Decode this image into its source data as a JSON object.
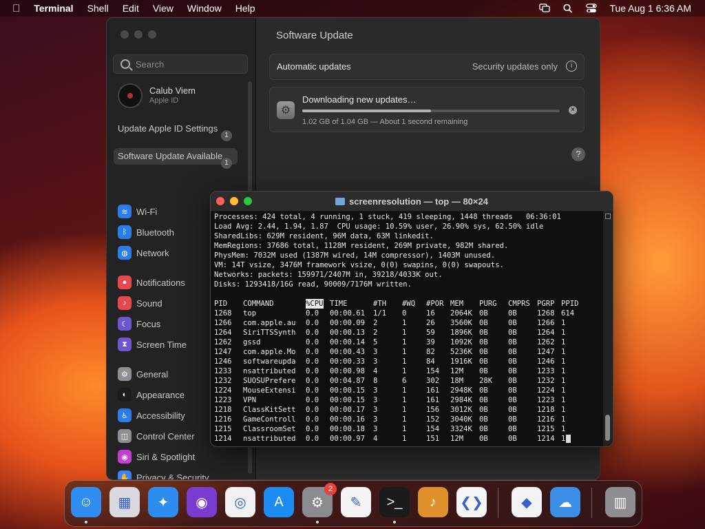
{
  "menubar": {
    "app": "Terminal",
    "items": [
      "Shell",
      "Edit",
      "View",
      "Window",
      "Help"
    ],
    "clock": "Tue Aug 1  6:36 AM"
  },
  "settings": {
    "search_placeholder": "Search",
    "account": {
      "name": "Calub Viem",
      "sub": "Apple ID"
    },
    "notices": [
      {
        "label": "Update Apple ID Settings",
        "badge": "1"
      },
      {
        "label": "Software Update Available",
        "badge": "1"
      }
    ],
    "nav": [
      {
        "label": "Wi-Fi",
        "color": "#2b7de9"
      },
      {
        "label": "Bluetooth",
        "color": "#2b7de9"
      },
      {
        "label": "Network",
        "color": "#2b7de9"
      },
      {
        "label": "Notifications",
        "color": "#e5484d"
      },
      {
        "label": "Sound",
        "color": "#e5484d"
      },
      {
        "label": "Focus",
        "color": "#6e56cf"
      },
      {
        "label": "Screen Time",
        "color": "#6e56cf"
      },
      {
        "label": "General",
        "color": "#8e8e93"
      },
      {
        "label": "Appearance",
        "color": "#1c1c1e"
      },
      {
        "label": "Accessibility",
        "color": "#2b7de9"
      },
      {
        "label": "Control Center",
        "color": "#8e8e93"
      },
      {
        "label": "Siri & Spotlight",
        "color": "#c23fd1"
      },
      {
        "label": "Privacy & Security",
        "color": "#3b82f6"
      }
    ],
    "title": "Software Update",
    "auto_updates": {
      "label": "Automatic updates",
      "value": "Security updates only"
    },
    "download": {
      "title": "Downloading new updates…",
      "status": "1.02 GB of 1.04 GB — About 1 second remaining",
      "progress": 0.5
    },
    "help": "?"
  },
  "terminal": {
    "title": "screenresolution — top — 80×24",
    "summary": [
      "Processes: 424 total, 4 running, 1 stuck, 419 sleeping, 1448 threads   06:36:01",
      "Load Avg: 2.44, 1.94, 1.87  CPU usage: 10.59% user, 26.90% sys, 62.50% idle",
      "SharedLibs: 629M resident, 96M data, 63M linkedit.",
      "MemRegions: 37686 total, 1128M resident, 269M private, 982M shared.",
      "PhysMem: 7032M used (1387M wired, 14M compressor), 1403M unused.",
      "VM: 14T vsize, 3476M framework vsize, 0(0) swapins, 0(0) swapouts.",
      "Networks: packets: 159971/2407M in, 39218/4033K out.",
      "Disks: 1293418/16G read, 90009/7176M written."
    ],
    "columns": [
      "PID",
      "COMMAND",
      "%CPU",
      "TIME",
      "#TH",
      "#WQ",
      "#POR",
      "MEM",
      "PURG",
      "CMPRS",
      "PGRP",
      "PPID"
    ],
    "rows": [
      [
        "1268",
        "top",
        "0.0",
        "00:00.61",
        "1/1",
        "0",
        "16",
        "2064K",
        "0B",
        "0B",
        "1268",
        "614"
      ],
      [
        "1266",
        "com.apple.au",
        "0.0",
        "00:00.09",
        "2",
        "1",
        "26",
        "3560K",
        "0B",
        "0B",
        "1266",
        "1"
      ],
      [
        "1264",
        "SiriTTSSynth",
        "0.0",
        "00:00.13",
        "2",
        "1",
        "59",
        "1896K",
        "0B",
        "0B",
        "1264",
        "1"
      ],
      [
        "1262",
        "gssd",
        "0.0",
        "00:00.14",
        "5",
        "1",
        "39",
        "1092K",
        "0B",
        "0B",
        "1262",
        "1"
      ],
      [
        "1247",
        "com.apple.Mo",
        "0.0",
        "00:00.43",
        "3",
        "1",
        "82",
        "5236K",
        "0B",
        "0B",
        "1247",
        "1"
      ],
      [
        "1246",
        "softwareupda",
        "0.0",
        "00:00.33",
        "3",
        "1",
        "84",
        "1916K",
        "0B",
        "0B",
        "1246",
        "1"
      ],
      [
        "1233",
        "nsattributed",
        "0.0",
        "00:00.98",
        "4",
        "1",
        "154",
        "12M",
        "0B",
        "0B",
        "1233",
        "1"
      ],
      [
        "1232",
        "SUOSUPrefere",
        "0.0",
        "00:04.87",
        "8",
        "6",
        "302",
        "18M",
        "28K",
        "0B",
        "1232",
        "1"
      ],
      [
        "1224",
        "MouseExtensi",
        "0.0",
        "00:00.15",
        "3",
        "1",
        "161",
        "2948K",
        "0B",
        "0B",
        "1224",
        "1"
      ],
      [
        "1223",
        "VPN",
        "0.0",
        "00:00.15",
        "3",
        "1",
        "161",
        "2984K",
        "0B",
        "0B",
        "1223",
        "1"
      ],
      [
        "1218",
        "ClassKitSett",
        "0.0",
        "00:00.17",
        "3",
        "1",
        "156",
        "3012K",
        "0B",
        "0B",
        "1218",
        "1"
      ],
      [
        "1216",
        "GameControll",
        "0.0",
        "00:00.16",
        "3",
        "1",
        "152",
        "3040K",
        "0B",
        "0B",
        "1216",
        "1"
      ],
      [
        "1215",
        "ClassroomSet",
        "0.0",
        "00:00.18",
        "3",
        "1",
        "154",
        "3324K",
        "0B",
        "0B",
        "1215",
        "1"
      ],
      [
        "1214",
        "nsattributed",
        "0.0",
        "00:00.97",
        "4",
        "1",
        "151",
        "12M",
        "0B",
        "0B",
        "1214",
        "1"
      ]
    ]
  },
  "dock": [
    {
      "name": "finder-icon",
      "glyph": "☺",
      "bg": "#2f8cf0",
      "dot": true
    },
    {
      "name": "launchpad-icon",
      "glyph": "▦",
      "bg": "#d9d9de",
      "dot": false
    },
    {
      "name": "safari-icon",
      "glyph": "✦",
      "bg": "#2d8cf0",
      "dot": false
    },
    {
      "name": "firefox-icon",
      "glyph": "◉",
      "bg": "#7a3bd0",
      "dot": false
    },
    {
      "name": "chrome-icon",
      "glyph": "◎",
      "bg": "#f1f1f1",
      "dot": false
    },
    {
      "name": "app-store-icon",
      "glyph": "A",
      "bg": "#1a8cf2",
      "dot": false
    },
    {
      "name": "system-settings-icon",
      "glyph": "⚙",
      "bg": "#8a8a8f",
      "dot": true,
      "badge": "2"
    },
    {
      "name": "textedit-icon",
      "glyph": "✎",
      "bg": "#f4f4f4",
      "dot": false
    },
    {
      "name": "terminal-icon",
      "glyph": ">_",
      "bg": "#1b1b1b",
      "dot": true
    },
    {
      "name": "garageband-icon",
      "glyph": "♪",
      "bg": "#e0902b",
      "dot": false
    },
    {
      "name": "vscode-icon",
      "glyph": "❮❯",
      "bg": "#f5f5f5",
      "dot": false
    },
    {
      "name": "visual-studio-icon",
      "glyph": "◆",
      "bg": "#f3f3f3",
      "dot": false
    },
    {
      "name": "weather-icon",
      "glyph": "☁",
      "bg": "#3b8fe6",
      "dot": false
    },
    {
      "name": "trash-icon",
      "glyph": "▥",
      "bg": "#8d8d92",
      "dot": false
    }
  ]
}
